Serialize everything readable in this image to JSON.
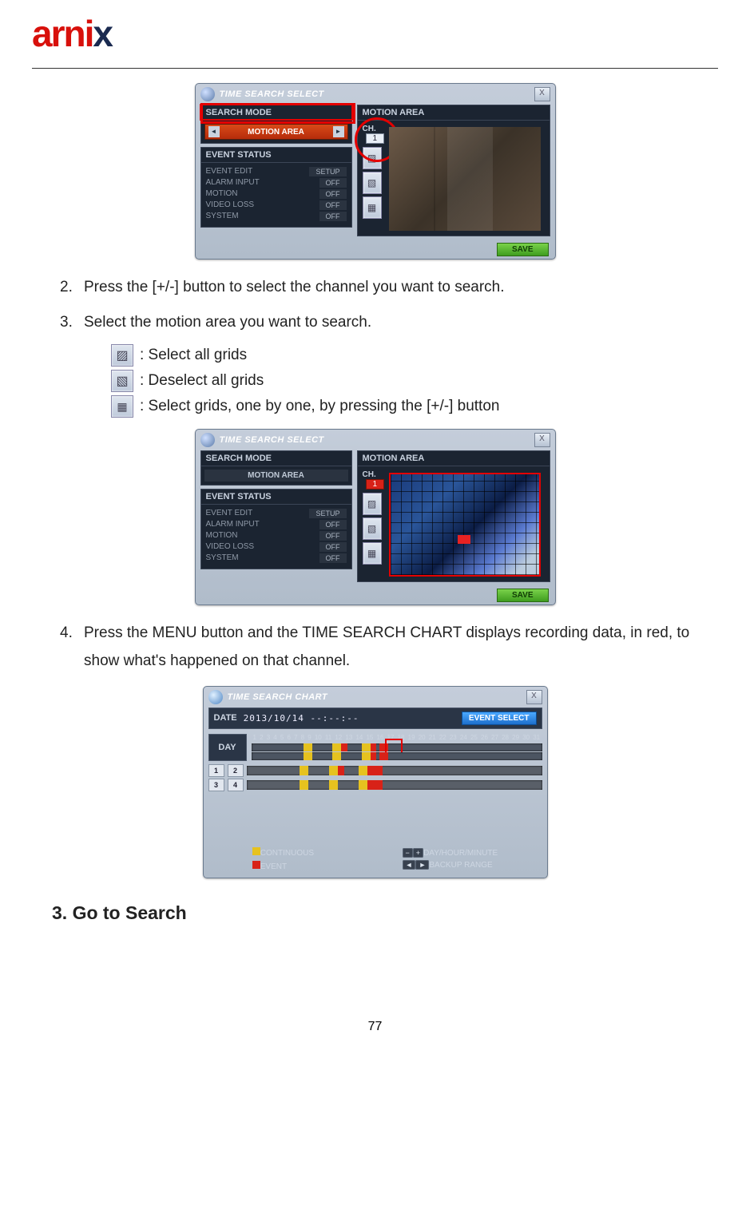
{
  "logo": {
    "part1": "arn",
    "part2": "i",
    "part3": "x"
  },
  "step2": {
    "num": "2.",
    "text": "Press the [+/-] button to select the channel you want to search."
  },
  "step3": {
    "num": "3.",
    "text": "Select the motion area you want to search."
  },
  "legend": {
    "select_all": ": Select all grids",
    "deselect_all": ": Deselect all grids",
    "one_by_one": ": Select grids, one by one, by pressing the [+/-] button"
  },
  "step4": {
    "num": "4.",
    "text": "Press the MENU button and the TIME SEARCH CHART displays recording data, in red, to show what's happened on that channel."
  },
  "section_heading": "3. Go to Search",
  "page_number": "77",
  "win1": {
    "title": "TIME SEARCH SELECT",
    "search_mode": "SEARCH MODE",
    "motion_area": "MOTION AREA",
    "dropdown": "MOTION AREA",
    "ch": "CH.",
    "ch_val": "1",
    "event_status": "EVENT STATUS",
    "rows": [
      {
        "k": "EVENT EDIT",
        "v": "SETUP"
      },
      {
        "k": "ALARM INPUT",
        "v": "OFF"
      },
      {
        "k": "MOTION",
        "v": "OFF"
      },
      {
        "k": "VIDEO LOSS",
        "v": "OFF"
      },
      {
        "k": "SYSTEM",
        "v": "OFF"
      }
    ],
    "save": "SAVE"
  },
  "chart": {
    "title": "TIME SEARCH CHART",
    "date_lbl": "DATE",
    "date_val": "2013/10/14 --:--:--",
    "event_select": "EVENT SELECT",
    "day_lbl": "DAY",
    "days": [
      "1",
      "2",
      "3",
      "4",
      "5",
      "6",
      "7",
      "8",
      "9",
      "10",
      "11",
      "12",
      "13",
      "14",
      "15",
      "16",
      "17",
      "18",
      "19",
      "20",
      "21",
      "22",
      "23",
      "24",
      "25",
      "26",
      "27",
      "28",
      "29",
      "30",
      "31"
    ],
    "ch_labels": [
      "1",
      "2",
      "3",
      "4"
    ],
    "legend_cont": "CONTINUOUS",
    "legend_event": "EVENT",
    "legend_dhm": "DAY/HOUR/MINUTE",
    "legend_backup": "BACKUP RANGE",
    "kbd_minus": "−",
    "kbd_plus": "+",
    "kbd_l": "◄",
    "kbd_r": "►"
  }
}
